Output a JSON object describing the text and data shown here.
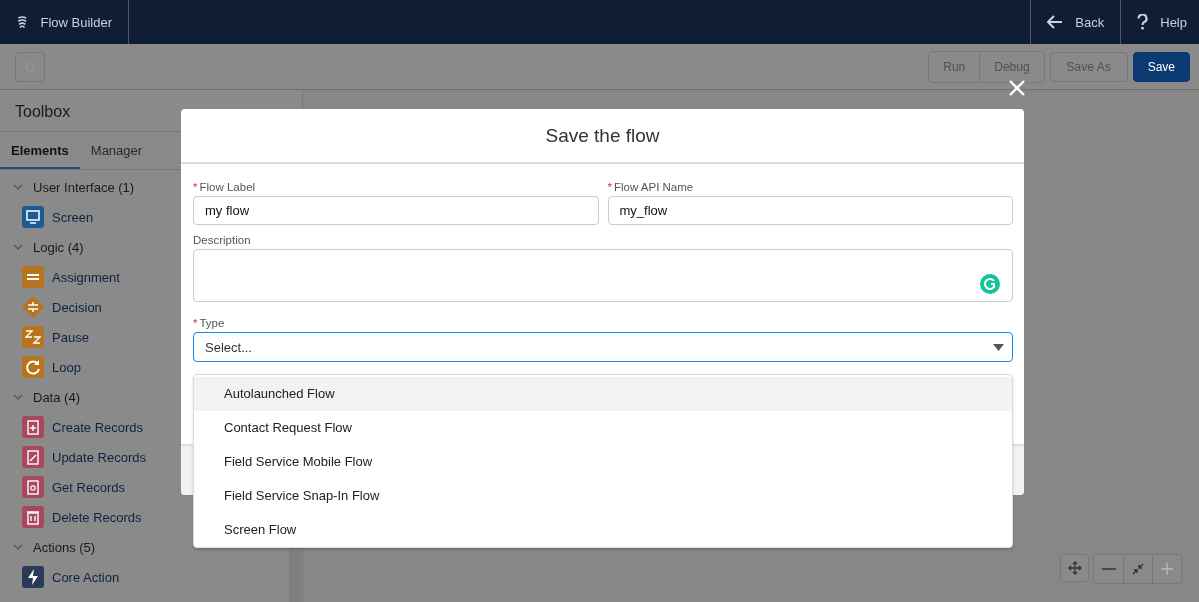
{
  "header": {
    "app_title": "Flow Builder",
    "nav": [
      {
        "kind": "back",
        "label": "Back"
      },
      {
        "kind": "help",
        "label": "Help"
      }
    ]
  },
  "toolbar": {
    "buttons": [
      {
        "label": "Run",
        "disabled": true,
        "primary": false
      },
      {
        "label": "Debug",
        "disabled": true,
        "primary": false
      },
      {
        "label": "Save As",
        "disabled": true,
        "primary": false
      },
      {
        "label": "Save",
        "disabled": false,
        "primary": true
      }
    ]
  },
  "toolbox": {
    "title": "Toolbox",
    "tabs": [
      {
        "label": "Elements",
        "selected": true
      },
      {
        "label": "Manager",
        "selected": false
      }
    ],
    "sections": [
      {
        "label": "User Interface (1)",
        "expanded": true,
        "items": [
          {
            "label": "Screen",
            "kind": "screen",
            "color": "#1c5a93"
          }
        ]
      },
      {
        "label": "Logic (4)",
        "expanded": true,
        "items": [
          {
            "label": "Assignment",
            "kind": "assignment",
            "color": "#b8731f"
          },
          {
            "label": "Decision",
            "kind": "decision",
            "color": "#b8731f"
          },
          {
            "label": "Pause",
            "kind": "pause",
            "color": "#b8731f"
          },
          {
            "label": "Loop",
            "kind": "loop",
            "color": "#b8731f"
          }
        ]
      },
      {
        "label": "Data (4)",
        "expanded": true,
        "items": [
          {
            "label": "Create Records",
            "kind": "create",
            "color": "#a8475e"
          },
          {
            "label": "Update Records",
            "kind": "update",
            "color": "#a8475e"
          },
          {
            "label": "Get Records",
            "kind": "get",
            "color": "#a8475e"
          },
          {
            "label": "Delete Records",
            "kind": "delete",
            "color": "#a8475e"
          }
        ]
      },
      {
        "label": "Actions (5)",
        "expanded": true,
        "items": [
          {
            "label": "Core Action",
            "kind": "action",
            "color": "#2a3a55"
          }
        ]
      }
    ]
  },
  "modal": {
    "title": "Save the flow",
    "flow_label": {
      "label": "Flow Label",
      "required_mark": "*",
      "value": "my flow"
    },
    "api_name": {
      "label": "Flow API Name",
      "required_mark": "*",
      "value": "my_flow"
    },
    "description": {
      "label": "Description"
    },
    "type": {
      "label": "Type",
      "required_mark": "*",
      "placeholder": "Select...",
      "expanded": true,
      "options": [
        {
          "label": "Autolaunched Flow",
          "highlighted": true
        },
        {
          "label": "Contact Request Flow",
          "highlighted": false
        },
        {
          "label": "Field Service Mobile Flow",
          "highlighted": false
        },
        {
          "label": "Field Service Snap-In Flow",
          "highlighted": false
        },
        {
          "label": "Screen Flow",
          "highlighted": false
        }
      ]
    }
  }
}
